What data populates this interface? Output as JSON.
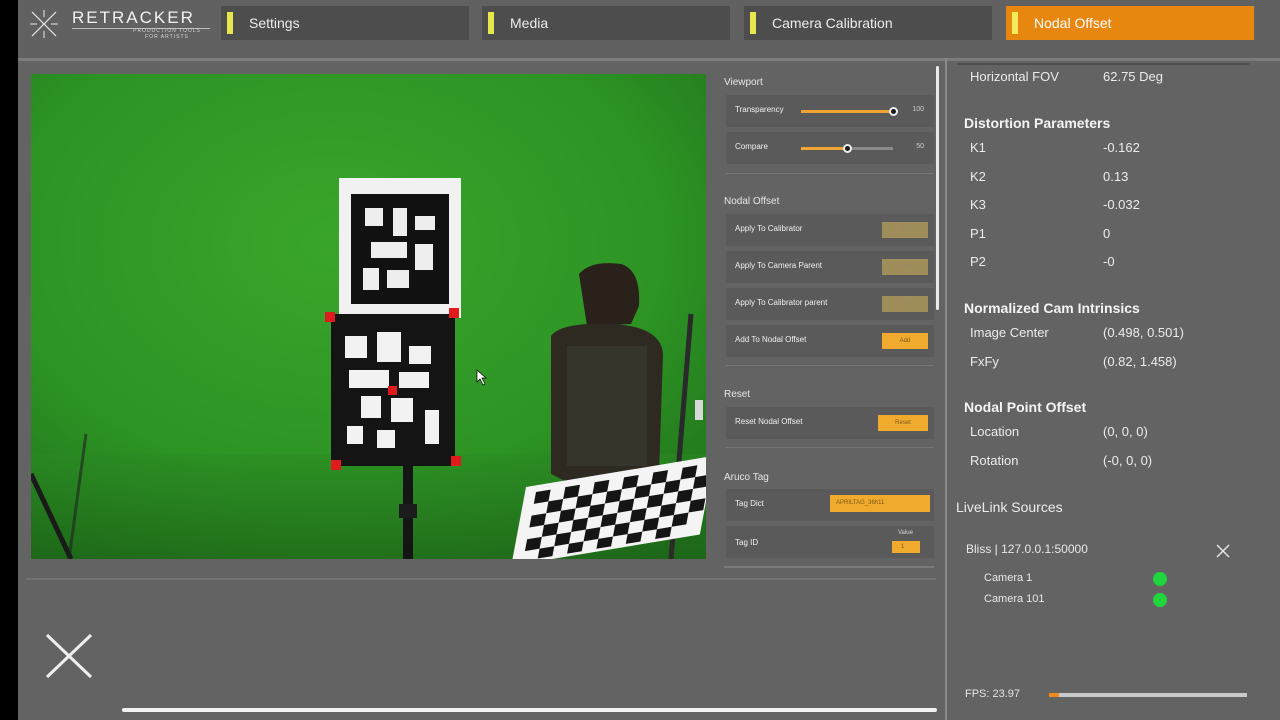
{
  "app": {
    "logo_title": "RETRACKER",
    "logo_subtitle": "PRODUCTION TOOLS FOR ARTISTS"
  },
  "tabs": [
    {
      "label": "Settings",
      "active": false
    },
    {
      "label": "Media",
      "active": false
    },
    {
      "label": "Camera Calibration",
      "active": false
    },
    {
      "label": "Nodal Offset",
      "active": true
    }
  ],
  "viewport_panel": {
    "title": "Viewport",
    "transparency": {
      "label": "Transparency",
      "value": "100",
      "level": 1.0
    },
    "compare": {
      "label": "Compare",
      "value": "50",
      "level": 0.5
    }
  },
  "nodal_offset_panel": {
    "title": "Nodal Offset",
    "rows": [
      {
        "label": "Apply To Calibrator",
        "button": "Add",
        "enabled": false
      },
      {
        "label": "Apply To Camera Parent",
        "button": "Add",
        "enabled": false
      },
      {
        "label": "Apply To Calibrator parent",
        "button": "Add",
        "enabled": false
      },
      {
        "label": "Add To Nodal Offset",
        "button": "Add",
        "enabled": true
      }
    ]
  },
  "reset_panel": {
    "title": "Reset",
    "row_label": "Reset Nodal Offset",
    "button": "Reset"
  },
  "aruco_panel": {
    "title": "Aruco Tag",
    "tag_dict_label": "Tag Dict",
    "tag_dict_value": "APRILTAG_36h11",
    "tag_id_label": "Tag ID",
    "tag_id_value_label": "Value",
    "tag_id_value": "1"
  },
  "info": {
    "horizontal_fov": {
      "label": "Horizontal FOV",
      "value": "62.75 Deg"
    },
    "distortion": {
      "title": "Distortion Parameters",
      "items": [
        {
          "label": "K1",
          "value": "-0.162"
        },
        {
          "label": "K2",
          "value": "0.13"
        },
        {
          "label": "K3",
          "value": "-0.032"
        },
        {
          "label": "P1",
          "value": "0"
        },
        {
          "label": "P2",
          "value": "-0"
        }
      ]
    },
    "intrinsics": {
      "title": "Normalized Cam Intrinsics",
      "items": [
        {
          "label": "Image Center",
          "value": "(0.498, 0.501)"
        },
        {
          "label": "FxFy",
          "value": "(0.82, 1.458)"
        }
      ]
    },
    "nodal_point": {
      "title": "Nodal Point Offset",
      "items": [
        {
          "label": "Location",
          "value": "(0, 0, 0)"
        },
        {
          "label": "Rotation",
          "value": "(-0, 0, 0)"
        }
      ]
    }
  },
  "livelink": {
    "title": "LiveLink Sources",
    "source": "Bliss | 127.0.0.1:50000",
    "cameras": [
      {
        "name": "Camera 1",
        "status_color": "#1fd63c"
      },
      {
        "name": "Camera 101",
        "status_color": "#1fd63c"
      }
    ]
  },
  "fps": {
    "label": "FPS:  23.97",
    "level": 0.05
  },
  "colors": {
    "accent": "#f0ab2f",
    "active_tab": "#e8870f",
    "tab_marker": "#e7e64a",
    "green_screen": "#2f9a25",
    "status_ok": "#1fd63c"
  }
}
